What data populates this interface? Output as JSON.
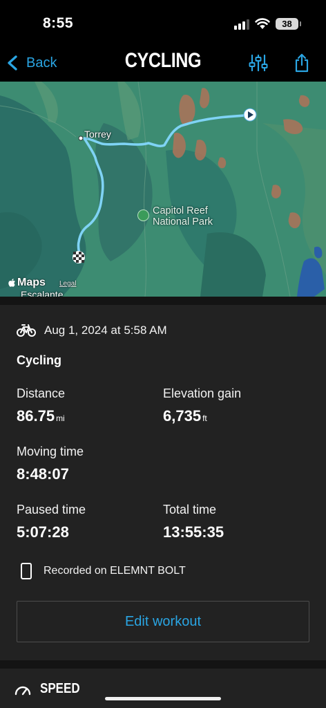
{
  "status_bar": {
    "time": "8:55",
    "battery": "38"
  },
  "nav": {
    "back_label": "Back",
    "title": "CYCLING"
  },
  "map": {
    "labels": {
      "torrey": "Torrey",
      "capitol_line1": "Capitol Reef",
      "capitol_line2": "National Park",
      "escalante": "Escalante"
    },
    "attribution": {
      "logo_text": "Maps",
      "legal": "Legal"
    },
    "route_color": "#7fd3f5",
    "colors": {
      "water_dark": "#2c7c74",
      "forest": "#3a8a70",
      "desert": "#b07a5a",
      "lake": "#2a5fa8"
    }
  },
  "workout": {
    "date": "Aug 1, 2024 at 5:58 AM",
    "type": "Cycling",
    "stats": {
      "distance": {
        "label": "Distance",
        "value": "86.75",
        "unit": "mi"
      },
      "elevation": {
        "label": "Elevation gain",
        "value": "6,735",
        "unit": "ft"
      },
      "moving": {
        "label": "Moving time",
        "value": "8:48:07"
      },
      "paused": {
        "label": "Paused time",
        "value": "5:07:28"
      },
      "total": {
        "label": "Total time",
        "value": "13:55:35"
      }
    },
    "device": "Recorded on ELEMNT BOLT",
    "edit_label": "Edit workout"
  },
  "speed_section": {
    "title": "SPEED"
  },
  "colors": {
    "accent": "#2aa5e3",
    "card_bg": "#222222",
    "background": "#000000"
  }
}
